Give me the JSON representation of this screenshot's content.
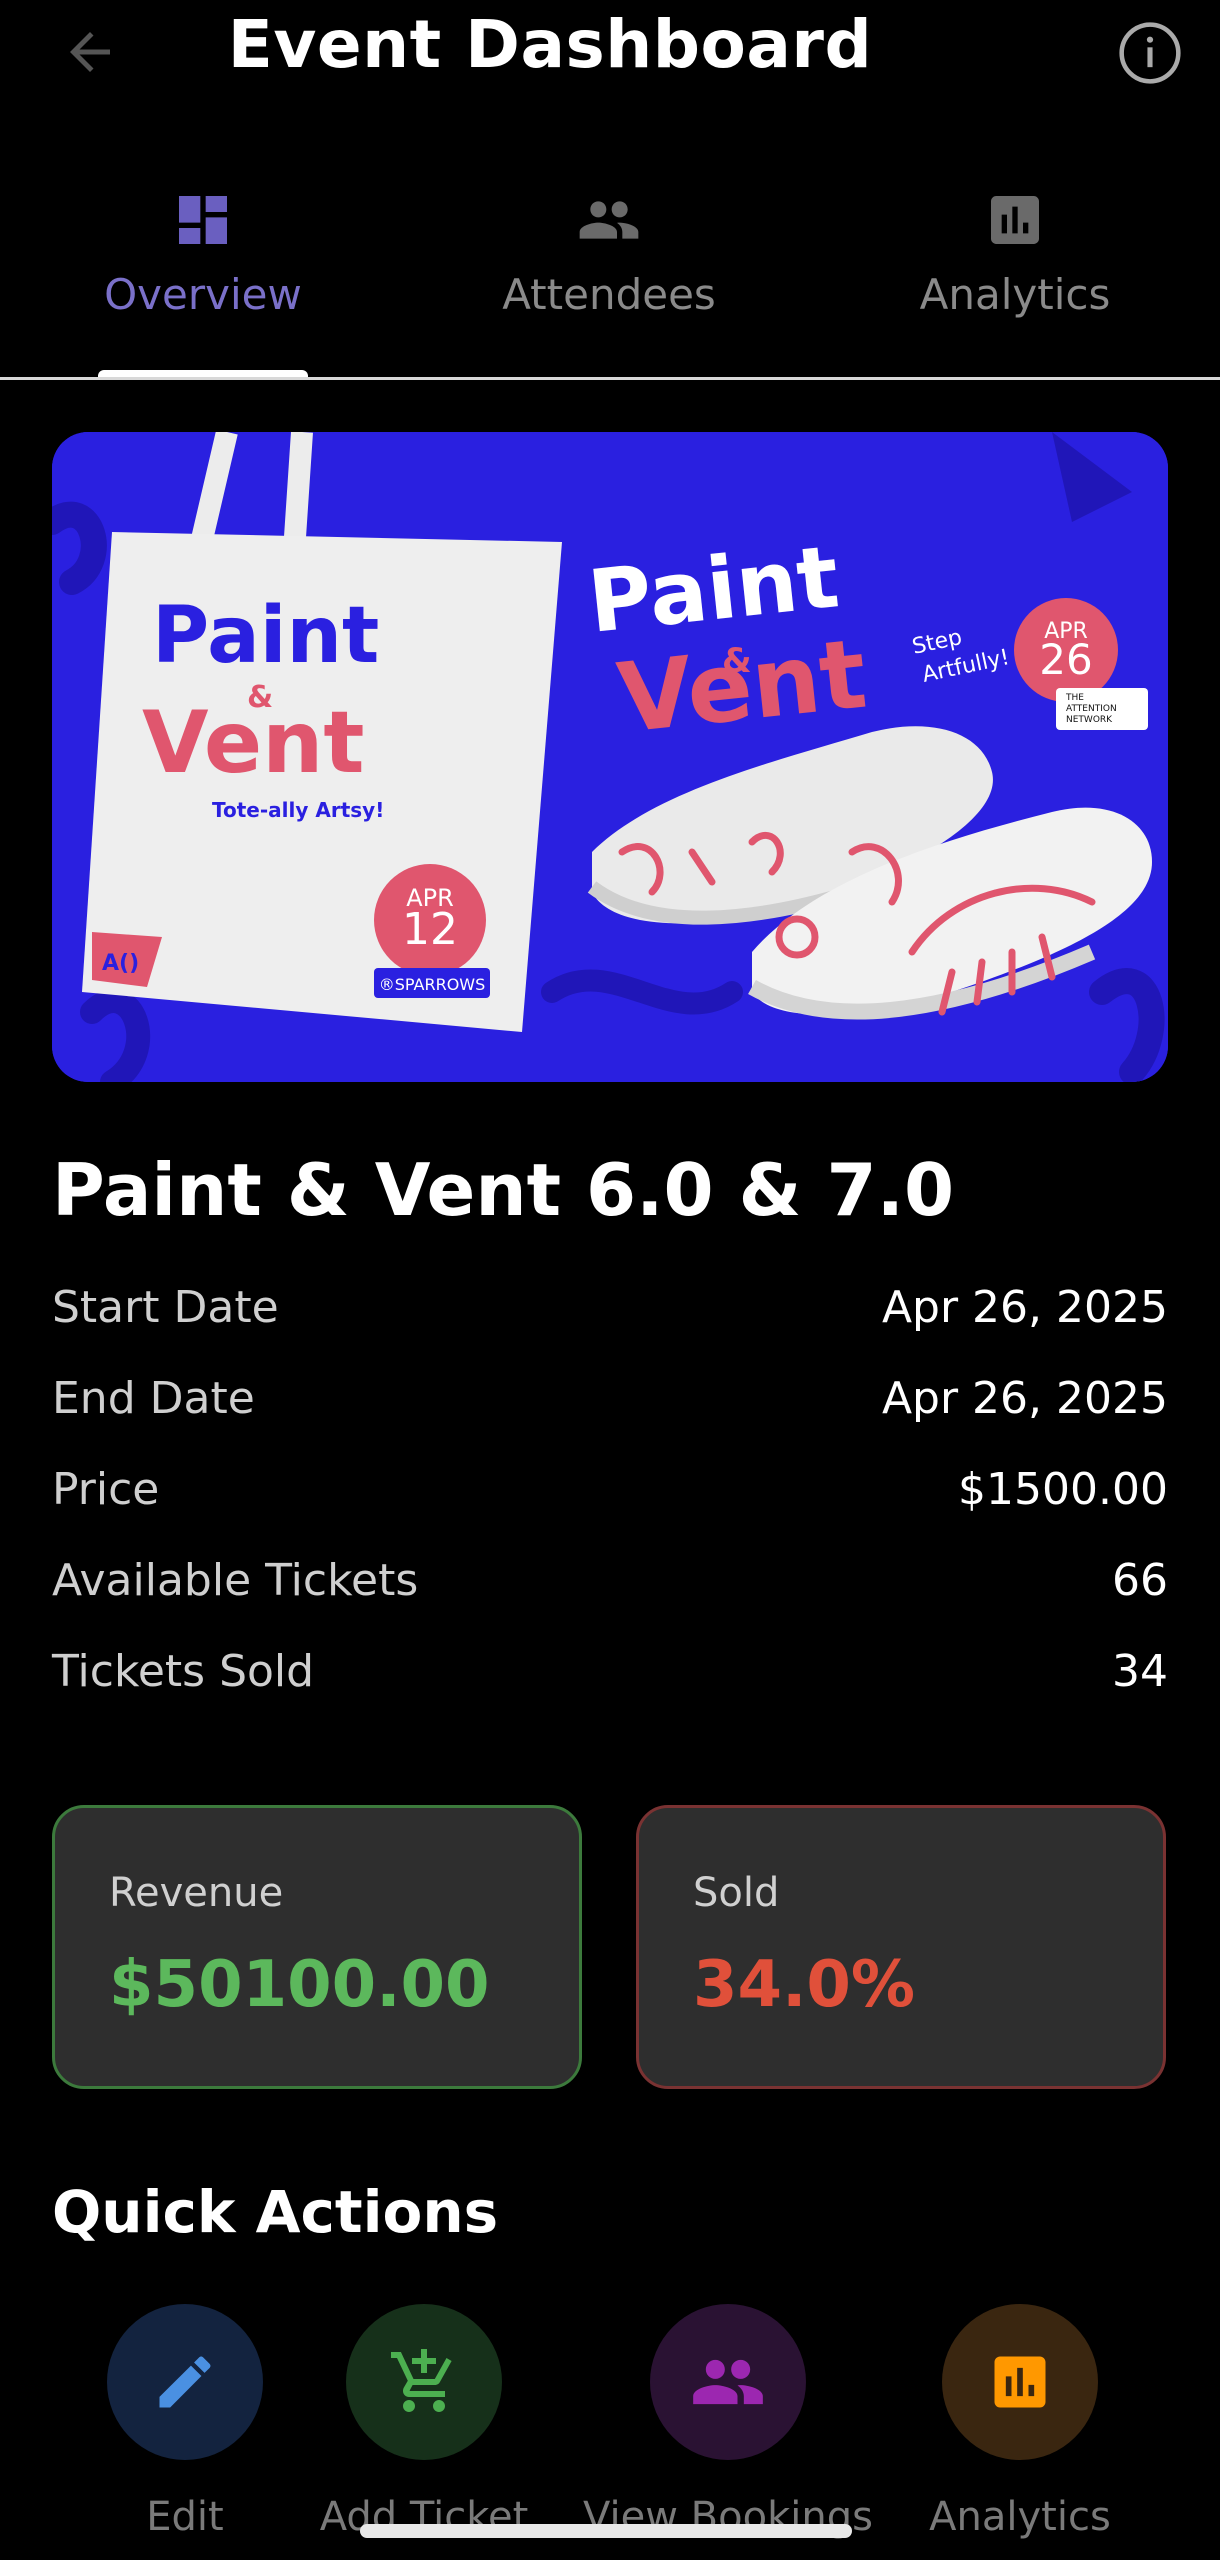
{
  "header": {
    "title": "Event Dashboard",
    "back_icon": "arrow-left-icon",
    "info_icon": "info-icon"
  },
  "tabs": [
    {
      "label": "Overview",
      "icon": "dashboard-grid-icon",
      "active": true
    },
    {
      "label": "Attendees",
      "icon": "people-icon",
      "active": false
    },
    {
      "label": "Analytics",
      "icon": "bar-chart-icon",
      "active": false
    }
  ],
  "banner": {
    "tote_title_1": "Paint",
    "tote_amp": "&",
    "tote_title_2": "Vent",
    "tote_tagline": "Tote-ally Artsy!",
    "tote_date_month": "APR",
    "tote_date_day": "12",
    "tote_sponsor": "®SPARROWS",
    "tote_logo": "A()",
    "shoe_title_1": "Paint",
    "shoe_amp": "&",
    "shoe_title_2": "Vent",
    "shoe_tagline_1": "Step",
    "shoe_tagline_2": "Artfully!",
    "shoe_date_month": "APR",
    "shoe_date_day": "26",
    "shoe_sponsor_1": "THE",
    "shoe_sponsor_2": "ATTENTION",
    "shoe_sponsor_3": "NETWORK",
    "bg_color": "#2a20e0",
    "accent_pink": "#e0566e"
  },
  "event": {
    "title": "Paint & Vent 6.0 & 7.0",
    "details": [
      {
        "label": "Start Date",
        "value": "Apr 26, 2025"
      },
      {
        "label": "End Date",
        "value": "Apr 26, 2025"
      },
      {
        "label": "Price",
        "value": "$1500.00"
      },
      {
        "label": "Available Tickets",
        "value": "66"
      },
      {
        "label": "Tickets Sold",
        "value": "34"
      }
    ]
  },
  "stats": {
    "revenue": {
      "label": "Revenue",
      "value": "$50100.00",
      "color": "#5cb85c"
    },
    "sold": {
      "label": "Sold",
      "value": "34.0%",
      "color": "#e0503a"
    }
  },
  "quick_actions": {
    "title": "Quick Actions",
    "items": [
      {
        "label": "Edit",
        "icon": "pencil-icon",
        "color": "#4a90e2",
        "bg": "#13233f"
      },
      {
        "label": "Add Ticket",
        "icon": "cart-add-icon",
        "color": "#4caf50",
        "bg": "#16301a"
      },
      {
        "label": "View Bookings",
        "icon": "people-icon",
        "color": "#9c27b0",
        "bg": "#2a1233"
      },
      {
        "label": "Analytics",
        "icon": "bar-chart-icon",
        "color": "#ff9800",
        "bg": "#3a2610"
      }
    ]
  }
}
